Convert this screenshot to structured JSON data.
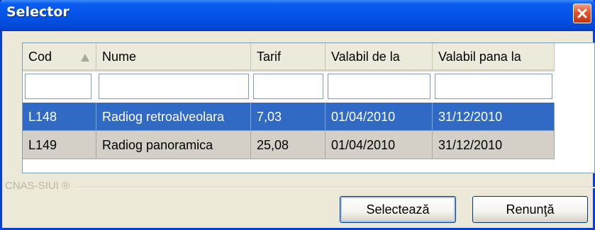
{
  "window": {
    "title": "Selector"
  },
  "grid": {
    "columns": [
      {
        "key": "cod",
        "label": "Cod",
        "sorted": "ascending"
      },
      {
        "key": "nume",
        "label": "Nume"
      },
      {
        "key": "tarif",
        "label": "Tarif"
      },
      {
        "key": "valabil_de_la",
        "label": "Valabil de la"
      },
      {
        "key": "valabil_pana_la",
        "label": "Valabil pana la"
      }
    ],
    "filters": [
      "",
      "",
      "",
      "",
      ""
    ],
    "rows": [
      {
        "cod": "L148",
        "nume": "Radiog retroalveolara",
        "tarif": "7,03",
        "valabil_de_la": "01/04/2010",
        "valabil_pana_la": "31/12/2010",
        "selected": true
      },
      {
        "cod": "L149",
        "nume": "Radiog panoramica",
        "tarif": "25,08",
        "valabil_de_la": "01/04/2010",
        "valabil_pana_la": "31/12/2010",
        "selected": false
      }
    ]
  },
  "footer": {
    "group_label": "CNAS-SIUI ®",
    "select_button": "Selectează",
    "cancel_button": "Renunţă"
  },
  "colors": {
    "titlebar": "#0453e8",
    "selection": "#316ac5",
    "window_bg": "#ece9d8"
  }
}
